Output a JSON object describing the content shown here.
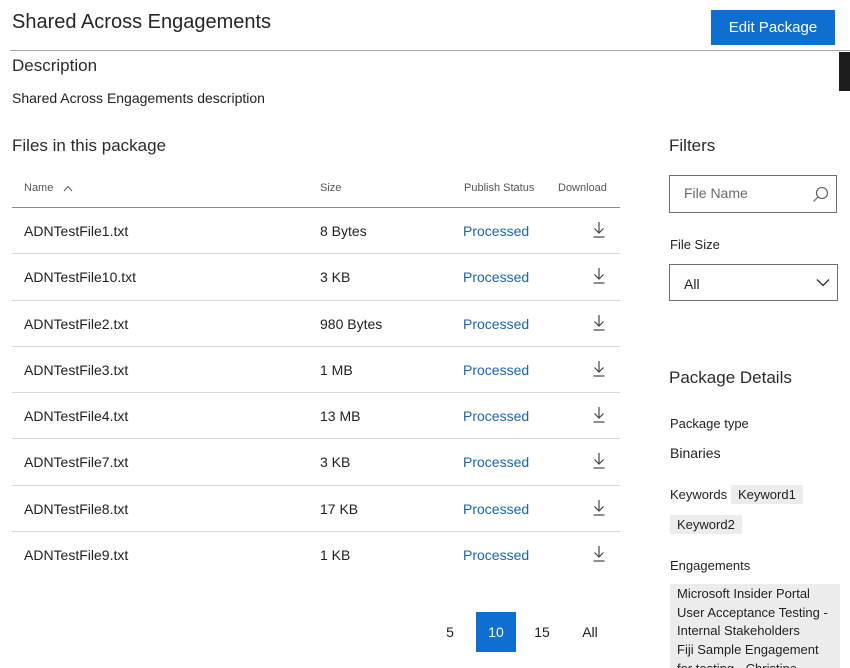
{
  "page": {
    "title": "Shared Across Engagements",
    "edit_button": "Edit Package"
  },
  "description": {
    "heading": "Description",
    "text": "Shared Across Engagements description"
  },
  "files": {
    "heading": "Files in this package",
    "columns": {
      "name": "Name",
      "size": "Size",
      "status": "Publish Status",
      "download": "Download"
    },
    "sort": {
      "column": "name",
      "direction": "ascending",
      "icon": "chevron-up-icon"
    },
    "rows": [
      {
        "name": "ADNTestFile1.txt",
        "size": "8 Bytes",
        "status": "Processed"
      },
      {
        "name": "ADNTestFile10.txt",
        "size": "3 KB",
        "status": "Processed"
      },
      {
        "name": "ADNTestFile2.txt",
        "size": "980 Bytes",
        "status": "Processed"
      },
      {
        "name": "ADNTestFile3.txt",
        "size": "1 MB",
        "status": "Processed"
      },
      {
        "name": "ADNTestFile4.txt",
        "size": "13 MB",
        "status": "Processed"
      },
      {
        "name": "ADNTestFile7.txt",
        "size": "3 KB",
        "status": "Processed"
      },
      {
        "name": "ADNTestFile8.txt",
        "size": "17 KB",
        "status": "Processed"
      },
      {
        "name": "ADNTestFile9.txt",
        "size": "1 KB",
        "status": "Processed"
      }
    ],
    "download_icon": "download-icon"
  },
  "pagination": {
    "options": [
      "5",
      "10",
      "15",
      "All"
    ],
    "selected": "10"
  },
  "filters": {
    "heading": "Filters",
    "file_name_placeholder": "File Name",
    "search_icon": "search-icon",
    "file_size_label": "File Size",
    "file_size_value": "All",
    "dropdown_icon": "chevron-down-icon"
  },
  "details": {
    "heading": "Package Details",
    "package_type_label": "Package type",
    "package_type_value": "Binaries",
    "keywords_label": "Keywords",
    "keywords": [
      "Keyword1",
      "Keyword2"
    ],
    "engagements_label": "Engagements",
    "engagements": [
      "Microsoft Insider Portal User Acceptance Testing - Internal Stakeholders",
      "Fiji Sample Engagement for testing - Christine"
    ]
  },
  "colors": {
    "accent": "#0f6fd0",
    "link": "#1b64b5",
    "chip_background": "#ececec"
  }
}
